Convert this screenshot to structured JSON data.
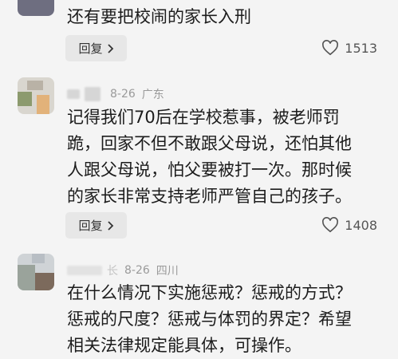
{
  "comments": [
    {
      "text_lines": [
        "还有要把校闹的家长入刑"
      ],
      "reply_label": "回复",
      "likes": "1513"
    },
    {
      "date": "8-26",
      "location": "广东",
      "text_lines": [
        "记得我们70后在学校惹事，被老师罚",
        "跪，回家不但不敢跟父母说，还怕其他",
        "人跟父母说，怕父要被打一次。那时候",
        "的家长非常支持老师严管自己的孩子。"
      ],
      "reply_label": "回复",
      "likes": "1408"
    },
    {
      "name_fragment": "长",
      "date": "8-26",
      "location": "四川",
      "text_lines": [
        "在什么情况下实施惩戒？惩戒的方式？",
        "惩戒的尺度？惩戒与体罚的界定？希望",
        "相关法律规定能具体，可操作。"
      ]
    }
  ],
  "icons": {
    "chevron": "chevron-right-icon",
    "like": "heart-outline-icon"
  }
}
